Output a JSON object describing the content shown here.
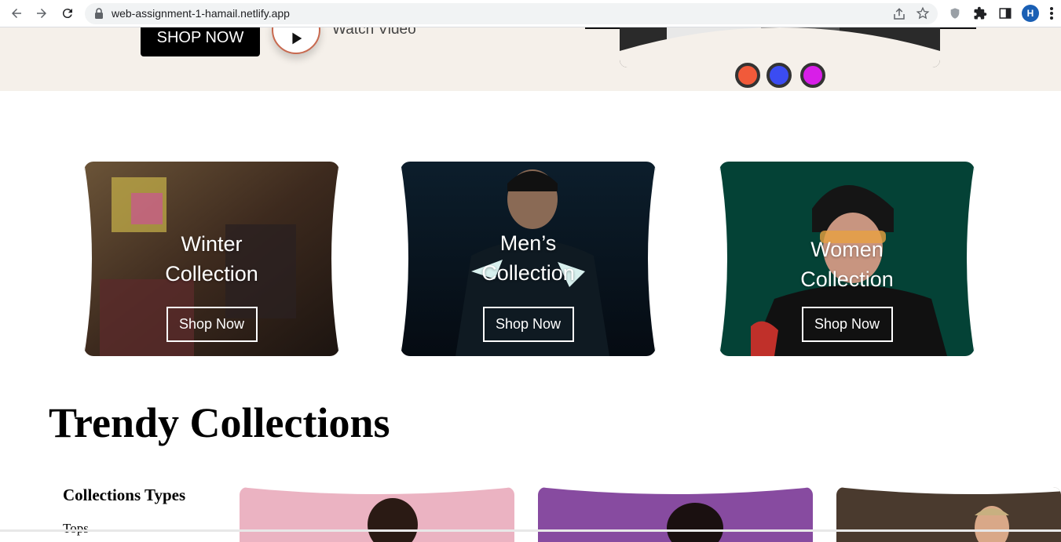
{
  "browser": {
    "url": "web-assignment-1-hamail.netlify.app",
    "avatar_letter": "H"
  },
  "hero": {
    "shop_label": "SHOP NOW",
    "watch_label": "Watch Video",
    "color_dots": [
      "#f15a3a",
      "#3b4cf2",
      "#d81ee8"
    ]
  },
  "cards": [
    {
      "title": "Winter\nCollection",
      "button": "Shop Now"
    },
    {
      "title": "Men’s\nCollection",
      "button": "Shop Now"
    },
    {
      "title": "Women\nCollection",
      "button": "Shop Now"
    }
  ],
  "trendy": {
    "heading": "Trendy Collections",
    "sidebar_title": "Collections Types",
    "sidebar_first_item": "Tops"
  }
}
